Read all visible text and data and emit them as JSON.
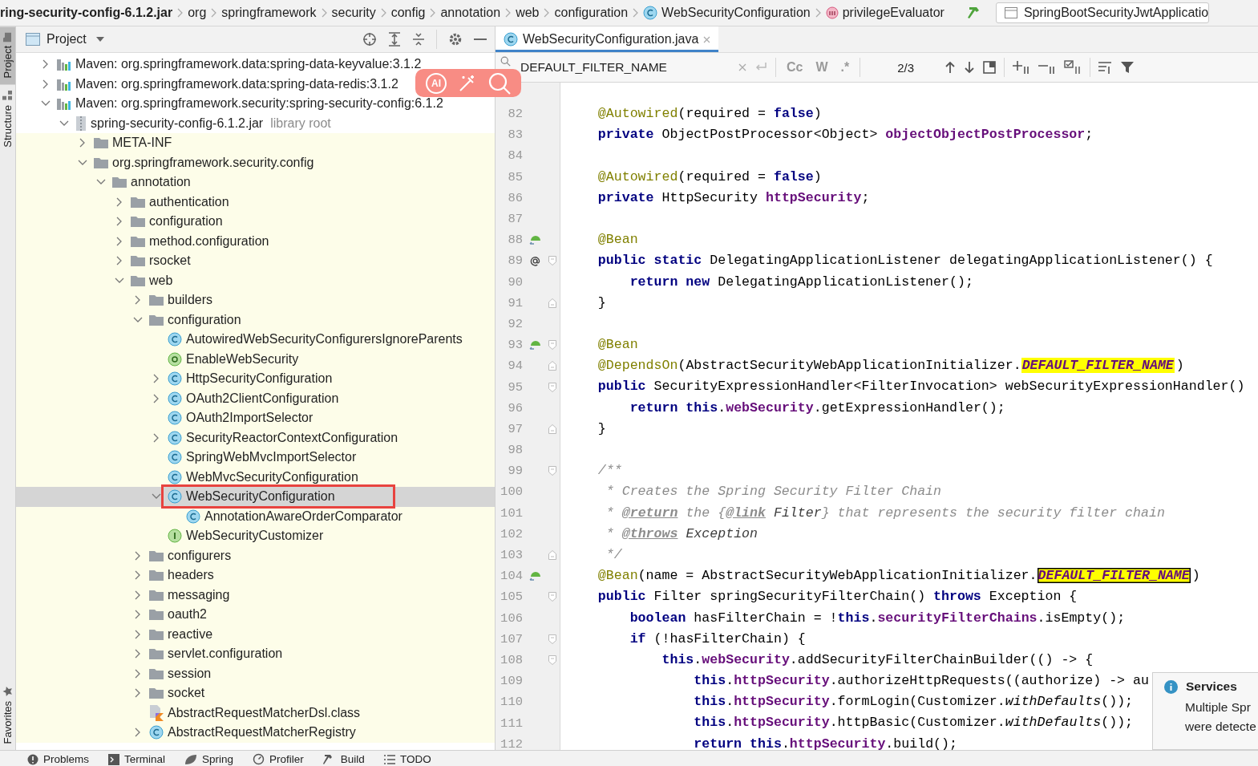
{
  "breadcrumbs": [
    {
      "label": "ring-security-config-6.1.2.jar",
      "kind": "jar"
    },
    {
      "label": "org",
      "kind": "package"
    },
    {
      "label": "springframework",
      "kind": "package"
    },
    {
      "label": "security",
      "kind": "package"
    },
    {
      "label": "config",
      "kind": "package"
    },
    {
      "label": "annotation",
      "kind": "package"
    },
    {
      "label": "web",
      "kind": "package"
    },
    {
      "label": "configuration",
      "kind": "package"
    },
    {
      "label": "WebSecurityConfiguration",
      "kind": "class"
    },
    {
      "label": "privilegeEvaluator",
      "kind": "method"
    }
  ],
  "run_config": "SpringBootSecurityJwtApplicatio",
  "side_tabs": [
    {
      "label": "Project",
      "selected": true
    },
    {
      "label": "Structure",
      "selected": false
    }
  ],
  "side_tabs_bottom": [
    {
      "label": "Favorites",
      "selected": false
    }
  ],
  "project": {
    "title": "Project",
    "tree": [
      {
        "label": "Maven: org.springframework.data:spring-data-keyvalue:3.1.2",
        "kind": "lib",
        "expanded": false,
        "selected": false
      },
      {
        "label": "Maven: org.springframework.data:spring-data-redis:3.1.2",
        "kind": "lib",
        "expanded": false,
        "selected": false
      },
      {
        "label": "Maven: org.springframework.security:spring-security-config:6.1.2",
        "kind": "lib",
        "expanded": true,
        "selected": false,
        "children": [
          {
            "label": "spring-security-config-6.1.2.jar",
            "hint": "library root",
            "kind": "jar",
            "expanded": true,
            "selected": false,
            "children": [
              {
                "label": "META-INF",
                "kind": "folder",
                "expanded": false,
                "selected": false
              },
              {
                "label": "org.springframework.security.config",
                "kind": "folder",
                "expanded": true,
                "selected": false,
                "children": [
                  {
                    "label": "annotation",
                    "kind": "folder",
                    "expanded": true,
                    "selected": false,
                    "children": [
                      {
                        "label": "authentication",
                        "kind": "folder",
                        "expanded": false,
                        "selected": false
                      },
                      {
                        "label": "configuration",
                        "kind": "folder",
                        "expanded": false,
                        "selected": false
                      },
                      {
                        "label": "method.configuration",
                        "kind": "folder",
                        "expanded": false,
                        "selected": false
                      },
                      {
                        "label": "rsocket",
                        "kind": "folder",
                        "expanded": false,
                        "selected": false
                      },
                      {
                        "label": "web",
                        "kind": "folder",
                        "expanded": true,
                        "selected": false,
                        "children": [
                          {
                            "label": "builders",
                            "kind": "folder",
                            "expanded": false,
                            "selected": false
                          },
                          {
                            "label": "configuration",
                            "kind": "folder",
                            "expanded": true,
                            "selected": false,
                            "children": [
                              {
                                "label": "AutowiredWebSecurityConfigurersIgnoreParents",
                                "kind": "class",
                                "selected": false
                              },
                              {
                                "label": "EnableWebSecurity",
                                "kind": "annotation",
                                "selected": false
                              },
                              {
                                "label": "HttpSecurityConfiguration",
                                "kind": "class",
                                "expanded": false,
                                "selected": false
                              },
                              {
                                "label": "OAuth2ClientConfiguration",
                                "kind": "class",
                                "expanded": false,
                                "selected": false
                              },
                              {
                                "label": "OAuth2ImportSelector",
                                "kind": "class",
                                "selected": false
                              },
                              {
                                "label": "SecurityReactorContextConfiguration",
                                "kind": "class",
                                "expanded": false,
                                "selected": false
                              },
                              {
                                "label": "SpringWebMvcImportSelector",
                                "kind": "class",
                                "selected": false
                              },
                              {
                                "label": "WebMvcSecurityConfiguration",
                                "kind": "class",
                                "selected": false
                              },
                              {
                                "label": "WebSecurityConfiguration",
                                "kind": "class",
                                "expanded": true,
                                "selected": true,
                                "outlined": true,
                                "children": [
                                  {
                                    "label": "AnnotationAwareOrderComparator",
                                    "kind": "class",
                                    "selected": false
                                  }
                                ]
                              },
                              {
                                "label": "WebSecurityCustomizer",
                                "kind": "interface",
                                "selected": false
                              }
                            ]
                          },
                          {
                            "label": "configurers",
                            "kind": "folder",
                            "expanded": false,
                            "selected": false
                          },
                          {
                            "label": "headers",
                            "kind": "folder",
                            "expanded": false,
                            "selected": false
                          },
                          {
                            "label": "messaging",
                            "kind": "folder",
                            "expanded": false,
                            "selected": false
                          },
                          {
                            "label": "oauth2",
                            "kind": "folder",
                            "expanded": false,
                            "selected": false
                          },
                          {
                            "label": "reactive",
                            "kind": "folder",
                            "expanded": false,
                            "selected": false
                          },
                          {
                            "label": "servlet.configuration",
                            "kind": "folder",
                            "expanded": false,
                            "selected": false
                          },
                          {
                            "label": "session",
                            "kind": "folder",
                            "expanded": false,
                            "selected": false
                          },
                          {
                            "label": "socket",
                            "kind": "folder",
                            "expanded": false,
                            "selected": false
                          },
                          {
                            "label": "AbstractRequestMatcherDsl.class",
                            "kind": "kotlin",
                            "selected": false
                          },
                          {
                            "label": "AbstractRequestMatcherRegistry",
                            "kind": "class",
                            "expanded": false,
                            "selected": false
                          }
                        ]
                      }
                    ]
                  }
                ]
              }
            ]
          }
        ]
      }
    ]
  },
  "ai_toolbar": {
    "label": "AI"
  },
  "editor": {
    "tab": {
      "label": "WebSecurityConfiguration.java",
      "selected": true
    },
    "search": {
      "value": "DEFAULT_FILTER_NAME",
      "toggles": [
        "Cc",
        "W",
        ".*"
      ],
      "count": "2/3"
    },
    "lines": [
      {
        "no": "82",
        "tokens": [
          {
            "t": "    @Autowired",
            "kind": "ann"
          },
          {
            "t": "(required = "
          },
          {
            "t": "false",
            "kind": "kw"
          },
          {
            "t": ")"
          }
        ]
      },
      {
        "no": "83",
        "tokens": [
          {
            "t": "    private",
            "kind": "kw"
          },
          {
            "t": " ObjectPostProcessor<Object> "
          },
          {
            "t": "objectObjectPostProcessor",
            "kind": "field"
          },
          {
            "t": ";"
          }
        ]
      },
      {
        "no": "84"
      },
      {
        "no": "85",
        "tokens": [
          {
            "t": "    @Autowired",
            "kind": "ann"
          },
          {
            "t": "(required = "
          },
          {
            "t": "false",
            "kind": "kw"
          },
          {
            "t": ")"
          }
        ]
      },
      {
        "no": "86",
        "tokens": [
          {
            "t": "    private",
            "kind": "kw"
          },
          {
            "t": " HttpSecurity "
          },
          {
            "t": "httpSecurity",
            "kind": "field"
          },
          {
            "t": ";"
          }
        ]
      },
      {
        "no": "87"
      },
      {
        "no": "88",
        "kind": "bean",
        "tokens": [
          {
            "t": "    @Bean",
            "kind": "ann"
          }
        ]
      },
      {
        "no": "89",
        "kind": "bean_ref",
        "fold_start": true,
        "tokens": [
          {
            "t": "    public static",
            "kind": "kw"
          },
          {
            "t": " DelegatingApplicationListener delegatingApplicationListener() {"
          }
        ]
      },
      {
        "no": "90",
        "tokens": [
          {
            "t": "        return new",
            "kind": "kw"
          },
          {
            "t": " DelegatingApplicationListener();"
          }
        ]
      },
      {
        "no": "91",
        "fold_end": true,
        "tokens": [
          {
            "t": "    }"
          }
        ]
      },
      {
        "no": "92"
      },
      {
        "no": "93",
        "kind": "bean",
        "fold_start": true,
        "tokens": [
          {
            "t": "    @Bean",
            "kind": "ann"
          }
        ]
      },
      {
        "no": "94",
        "fold_end": true,
        "tokens": [
          {
            "t": "    @DependsOn",
            "kind": "ann"
          },
          {
            "t": "(AbstractSecurityWebApplicationInitializer."
          },
          {
            "t": "DEFAULT_FILTER_NAME",
            "kind": "match"
          },
          {
            "t": ")"
          }
        ]
      },
      {
        "no": "95",
        "fold_start": true,
        "tokens": [
          {
            "t": "    public",
            "kind": "kw"
          },
          {
            "t": " SecurityExpressionHandler<FilterInvocation> webSecurityExpressionHandler()"
          }
        ]
      },
      {
        "no": "96",
        "tokens": [
          {
            "t": "        return this",
            "kind": "kw"
          },
          {
            "t": "."
          },
          {
            "t": "webSecurity",
            "kind": "field"
          },
          {
            "t": ".getExpressionHandler();"
          }
        ]
      },
      {
        "no": "97",
        "fold_end": true,
        "tokens": [
          {
            "t": "    }"
          }
        ]
      },
      {
        "no": "98"
      },
      {
        "no": "99",
        "fold_start": true,
        "tokens": [
          {
            "t": "    /**",
            "kind": "comment"
          }
        ]
      },
      {
        "no": "100",
        "tokens": [
          {
            "t": "     * Creates the Spring Security Filter Chain",
            "kind": "comment"
          }
        ]
      },
      {
        "no": "101",
        "tokens": [
          {
            "t": "     * ",
            "kind": "comment"
          },
          {
            "t": "@return",
            "kind": "doctag"
          },
          {
            "t": " the {",
            "kind": "comment"
          },
          {
            "t": "@link",
            "kind": "doctag"
          },
          {
            "t": " Filter",
            "kind": "docref"
          },
          {
            "t": "} that represents the security filter chain",
            "kind": "comment"
          }
        ]
      },
      {
        "no": "102",
        "tokens": [
          {
            "t": "     * ",
            "kind": "comment"
          },
          {
            "t": "@throws",
            "kind": "doctag"
          },
          {
            "t": " Exception",
            "kind": "docref"
          }
        ]
      },
      {
        "no": "103",
        "fold_end": true,
        "tokens": [
          {
            "t": "     */",
            "kind": "comment"
          }
        ]
      },
      {
        "no": "104",
        "kind": "bean",
        "tokens": [
          {
            "t": "    @Bean",
            "kind": "ann"
          },
          {
            "t": "(name = AbstractSecurityWebApplicationInitializer."
          },
          {
            "t": "DEFAULT_FILTER_NAME",
            "kind": "match_current"
          },
          {
            "t": ")"
          }
        ]
      },
      {
        "no": "105",
        "fold_start": true,
        "tokens": [
          {
            "t": "    public",
            "kind": "kw"
          },
          {
            "t": " Filter springSecurityFilterChain() "
          },
          {
            "t": "throws",
            "kind": "kw"
          },
          {
            "t": " Exception {"
          }
        ]
      },
      {
        "no": "106",
        "tokens": [
          {
            "t": "        boolean",
            "kind": "kw"
          },
          {
            "t": " hasFilterChain = !"
          },
          {
            "t": "this",
            "kind": "kw"
          },
          {
            "t": "."
          },
          {
            "t": "securityFilterChains",
            "kind": "field"
          },
          {
            "t": ".isEmpty();"
          }
        ]
      },
      {
        "no": "107",
        "fold_start": true,
        "tokens": [
          {
            "t": "        if",
            "kind": "kw"
          },
          {
            "t": " (!hasFilterChain) {"
          }
        ]
      },
      {
        "no": "108",
        "fold_start": true,
        "tokens": [
          {
            "t": "            this",
            "kind": "kw"
          },
          {
            "t": "."
          },
          {
            "t": "webSecurity",
            "kind": "field"
          },
          {
            "t": ".addSecurityFilterChainBuilder(() -> {"
          }
        ]
      },
      {
        "no": "109",
        "tokens": [
          {
            "t": "                this",
            "kind": "kw"
          },
          {
            "t": "."
          },
          {
            "t": "httpSecurity",
            "kind": "field"
          },
          {
            "t": ".authorizeHttpRequests((authorize) -> au"
          }
        ]
      },
      {
        "no": "110",
        "tokens": [
          {
            "t": "                this",
            "kind": "kw"
          },
          {
            "t": "."
          },
          {
            "t": "httpSecurity",
            "kind": "field"
          },
          {
            "t": ".formLogin(Customizer."
          },
          {
            "t": "withDefaults",
            "kind": "italic"
          },
          {
            "t": "());"
          }
        ]
      },
      {
        "no": "111",
        "tokens": [
          {
            "t": "                this",
            "kind": "kw"
          },
          {
            "t": "."
          },
          {
            "t": "httpSecurity",
            "kind": "field"
          },
          {
            "t": ".httpBasic(Customizer."
          },
          {
            "t": "withDefaults",
            "kind": "italic"
          },
          {
            "t": "());"
          }
        ]
      },
      {
        "no": "112",
        "tokens": [
          {
            "t": "                return this",
            "kind": "kw"
          },
          {
            "t": "."
          },
          {
            "t": "httpSecurity",
            "kind": "field"
          },
          {
            "t": ".build();"
          }
        ]
      }
    ]
  },
  "notification": {
    "title": "Services",
    "lines": [
      "Multiple Spr",
      "were detecte"
    ]
  },
  "bottom_tools": [
    {
      "label": "Problems"
    },
    {
      "label": "Terminal"
    },
    {
      "label": "Spring"
    },
    {
      "label": "Profiler"
    },
    {
      "label": "Build"
    },
    {
      "label": "TODO"
    }
  ]
}
